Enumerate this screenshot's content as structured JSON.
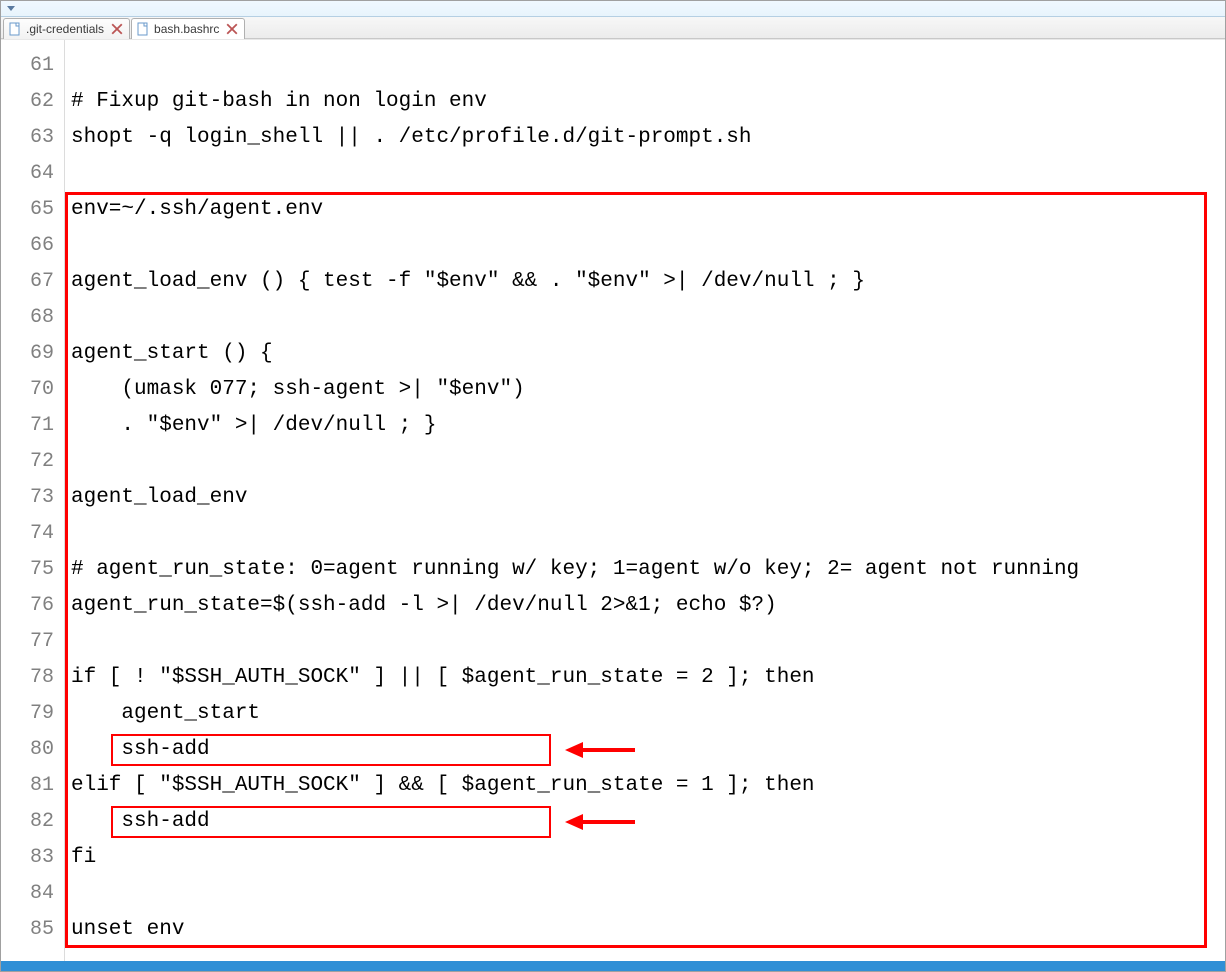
{
  "tabs": [
    {
      "label": ".git-credentials",
      "active": false
    },
    {
      "label": "bash.bashrc",
      "active": true
    }
  ],
  "firstLine": 61,
  "lines": [
    "",
    "# Fixup git-bash in non login env",
    "shopt -q login_shell || . /etc/profile.d/git-prompt.sh",
    "",
    "env=~/.ssh/agent.env",
    "",
    "agent_load_env () { test -f \"$env\" && . \"$env\" >| /dev/null ; }",
    "",
    "agent_start () {",
    "    (umask 077; ssh-agent >| \"$env\")",
    "    . \"$env\" >| /dev/null ; }",
    "",
    "agent_load_env",
    "",
    "# agent_run_state: 0=agent running w/ key; 1=agent w/o key; 2= agent not running",
    "agent_run_state=$(ssh-add -l >| /dev/null 2>&1; echo $?)",
    "",
    "if [ ! \"$SSH_AUTH_SOCK\" ] || [ $agent_run_state = 2 ]; then",
    "    agent_start",
    "    ssh-add",
    "elif [ \"$SSH_AUTH_SOCK\" ] && [ $agent_run_state = 1 ]; then",
    "    ssh-add",
    "fi",
    "",
    "unset env"
  ],
  "annotations": {
    "bigBox": {
      "fromLine": 65,
      "toLine": 85
    },
    "innerBoxes": [
      {
        "line": 80
      },
      {
        "line": 82
      }
    ]
  }
}
